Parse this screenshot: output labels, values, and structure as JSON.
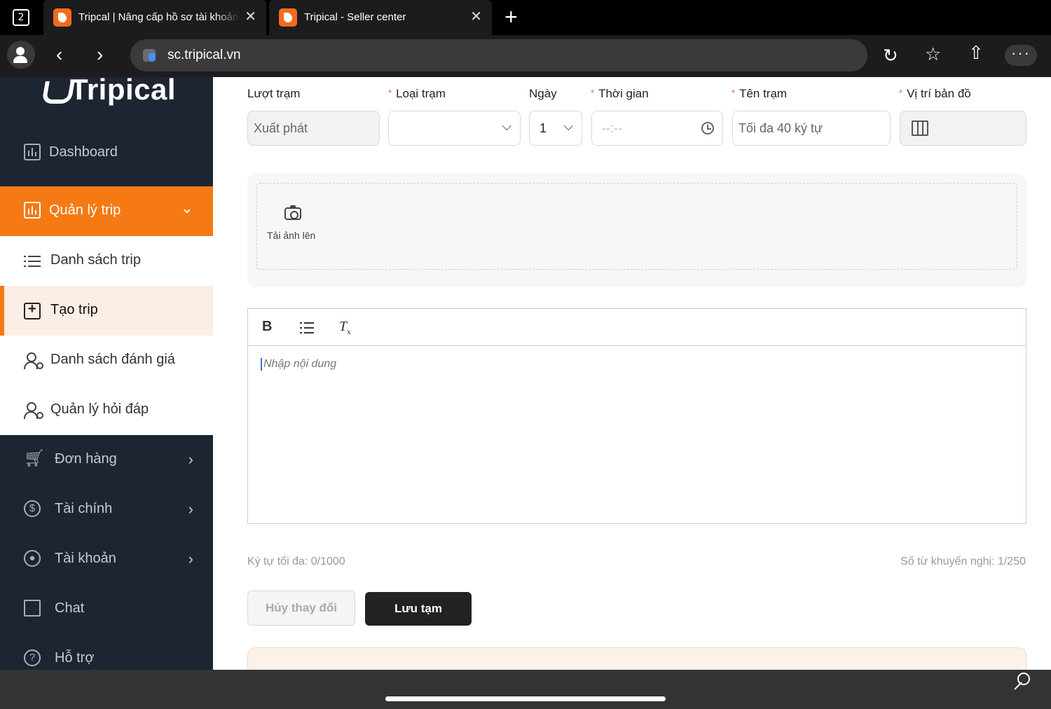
{
  "browser": {
    "tab_count": "2",
    "tabs": [
      {
        "title": "Tripcal | Nâng cấp hồ sơ tài khoản"
      },
      {
        "title": "Tripical - Seller center"
      }
    ],
    "url": "sc.tripical.vn",
    "icons": [
      "profile-icon",
      "back-icon",
      "forward-icon",
      "reload-icon",
      "favorites-icon",
      "share-icon",
      "more-icon",
      "key-icon"
    ]
  },
  "sidebar": {
    "logo": "Tripical",
    "items": [
      {
        "label": "Dashboard",
        "icon": "chart-icon"
      },
      {
        "label": "Quản lý trip",
        "icon": "chart-icon",
        "active": true
      },
      {
        "label": "Đơn hàng",
        "icon": "cart-icon"
      },
      {
        "label": "Tài chính",
        "icon": "dollar-icon"
      },
      {
        "label": "Tài khoản",
        "icon": "user-circle-icon"
      },
      {
        "label": "Chat",
        "icon": "chat-icon"
      },
      {
        "label": "Hỗ trợ",
        "icon": "help-icon"
      }
    ],
    "submenu": [
      {
        "label": "Danh sách trip",
        "icon": "list-icon"
      },
      {
        "label": "Tạo trip",
        "icon": "add-box-icon",
        "active": true
      },
      {
        "label": "Danh sách đánh giá",
        "icon": "user-gear-icon"
      },
      {
        "label": "Quản lý hỏi đáp",
        "icon": "user-gear-icon"
      }
    ]
  },
  "form": {
    "labels": {
      "luot_tram": "Lượt trạm",
      "loai_tram": "Loại trạm",
      "ngay": "Ngày",
      "thoi_gian": "Thời gian",
      "ten_tram": "Tên trạm",
      "vi_tri": "Vị trí bản đồ"
    },
    "required_mark": "*",
    "values": {
      "luot_tram": "Xuất phát",
      "loai_tram": "",
      "ngay": "1",
      "thoi_gian_placeholder": "--:--",
      "ten_tram_placeholder": "Tối đa 40 ký tự"
    }
  },
  "upload": {
    "label": "Tải ảnh lên"
  },
  "editor": {
    "tools": {
      "bold": "B",
      "clear": "T"
    },
    "placeholder": "Nhập nội dung"
  },
  "counters": {
    "max_chars": "Ký tự tối đa:  0/1000",
    "suggested_words": "Số từ khuyến nghị:  1/250"
  },
  "buttons": {
    "cancel": "Hủy thay đổi",
    "save": "Lưu tạm"
  },
  "info_card": {
    "title": ""
  },
  "colors": {
    "accent": "#f57a14",
    "sidebar_bg": "#1e2532",
    "submenu_active_bg": "#fbeee4",
    "save_button": "#222222"
  }
}
